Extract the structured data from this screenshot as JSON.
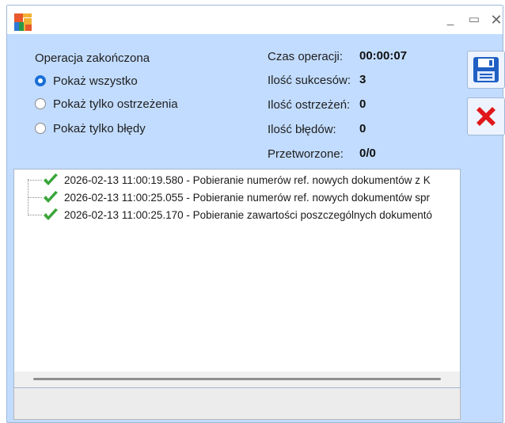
{
  "window": {
    "minimize_glyph": "_",
    "maximize_glyph": "▭",
    "close_glyph": "✕"
  },
  "status": {
    "heading": "Operacja zakończona"
  },
  "filters": [
    {
      "label": "Pokaż wszystko",
      "checked": true
    },
    {
      "label": "Pokaż tylko ostrzeżenia",
      "checked": false
    },
    {
      "label": "Pokaż tylko błędy",
      "checked": false
    }
  ],
  "stats": {
    "time_label": "Czas operacji:",
    "time_value": "00:00:07",
    "success_label": "Ilość sukcesów:",
    "success_value": "3",
    "warning_label": "Ilość ostrzeżeń:",
    "warning_value": "0",
    "error_label": "Ilość błędów:",
    "error_value": "0",
    "processed_label": "Przetworzone:",
    "processed_value": "0/0"
  },
  "log": {
    "entries": [
      {
        "text": "2026-02-13 11:00:19.580 - Pobieranie numerów ref. nowych dokumentów z K",
        "icon": "check-icon",
        "status_color": "#3aa53a"
      },
      {
        "text": "2026-02-13 11:00:25.055 - Pobieranie numerów ref. nowych dokumentów spr",
        "icon": "check-icon",
        "status_color": "#3aa53a"
      },
      {
        "text": "2026-02-13 11:00:25.170 - Pobieranie zawartości poszczególnych dokumentó",
        "icon": "check-icon",
        "status_color": "#3aa53a"
      }
    ]
  },
  "actions": {
    "save_icon": "save-icon",
    "cancel_icon": "close-x-icon"
  },
  "colors": {
    "window_bg": "#c2dcff",
    "accent": "#1a6fd6",
    "cancel_red": "#e0171b"
  }
}
